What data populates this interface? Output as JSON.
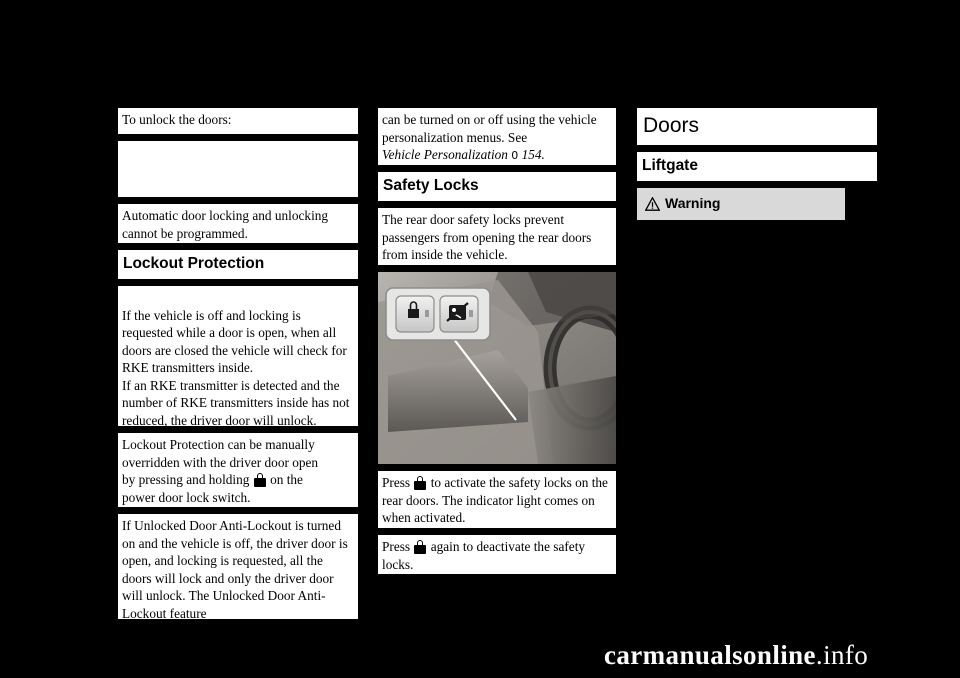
{
  "page": {
    "background_color": "#000000",
    "watermark": {
      "part1": "carmanualsonline",
      "part2": ".info"
    }
  },
  "column1": {
    "blocks": [
      {
        "type": "text",
        "text": "To unlock the doors:"
      },
      {
        "type": "spacer"
      },
      {
        "type": "text",
        "text": "Automatic door locking and unlocking cannot be programmed."
      },
      {
        "type": "heading",
        "text": "Lockout Protection"
      },
      {
        "type": "text",
        "text": "If the vehicle is off and locking is requested while a door is open, when all doors are closed the vehicle will check for RKE transmitters inside.\nIf an RKE transmitter is detected and the number of RKE transmitters inside has not reduced, the driver door will unlock."
      },
      {
        "type": "text_with_lock",
        "before": "Lockout Protection can be manually overridden with the driver door open",
        "mid_before": "by pressing and holding",
        "mid_after": "on the",
        "after": "power door lock switch."
      },
      {
        "type": "text",
        "text": "If Unlocked Door Anti-Lockout is turned on and the vehicle is off, the driver door is open, and locking is requested, all the doors will lock and only the driver door will unlock. The Unlocked Door Anti-Lockout feature"
      }
    ]
  },
  "column2": {
    "continued_text": "can be turned on or off using the vehicle personalization menus. See",
    "reference": {
      "title": "Vehicle Personalization",
      "arrow": "0",
      "page": "154."
    },
    "heading": "Safety Locks",
    "intro": "The rear door safety locks prevent passengers from opening the rear doors from inside the vehicle.",
    "figure": {
      "name": "safety-lock-switch-photo",
      "caption": "",
      "button_left_label": "door-lock-icon",
      "button_right_label": "child-lock-icon"
    },
    "press_activate": {
      "before": "Press",
      "after": "to activate the safety locks on the rear doors. The indicator light comes on when activated."
    },
    "press_deactivate": {
      "before": "Press",
      "after": "again to deactivate the safety locks."
    }
  },
  "column3": {
    "title": "Doors",
    "subtitle": "Liftgate",
    "warning": {
      "icon": "warning-triangle-icon",
      "label": "Warning"
    }
  }
}
